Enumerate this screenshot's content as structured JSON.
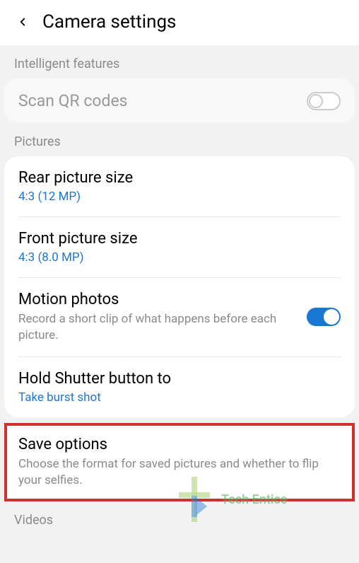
{
  "header": {
    "title": "Camera settings"
  },
  "sections": {
    "intelligent": "Intelligent features",
    "pictures": "Pictures",
    "videos": "Videos"
  },
  "items": {
    "qr": {
      "title": "Scan QR codes"
    },
    "rearSize": {
      "title": "Rear picture size",
      "value": "4:3 (12 MP)"
    },
    "frontSize": {
      "title": "Front picture size",
      "value": "4:3 (8.0 MP)"
    },
    "motion": {
      "title": "Motion photos",
      "desc": "Record a short clip of what happens before each picture."
    },
    "shutter": {
      "title": "Hold Shutter button to",
      "value": "Take burst shot"
    },
    "save": {
      "title": "Save options",
      "desc": "Choose the format for saved pictures and whether to flip your selfies."
    }
  },
  "watermark": {
    "text": "Tech Entice"
  }
}
